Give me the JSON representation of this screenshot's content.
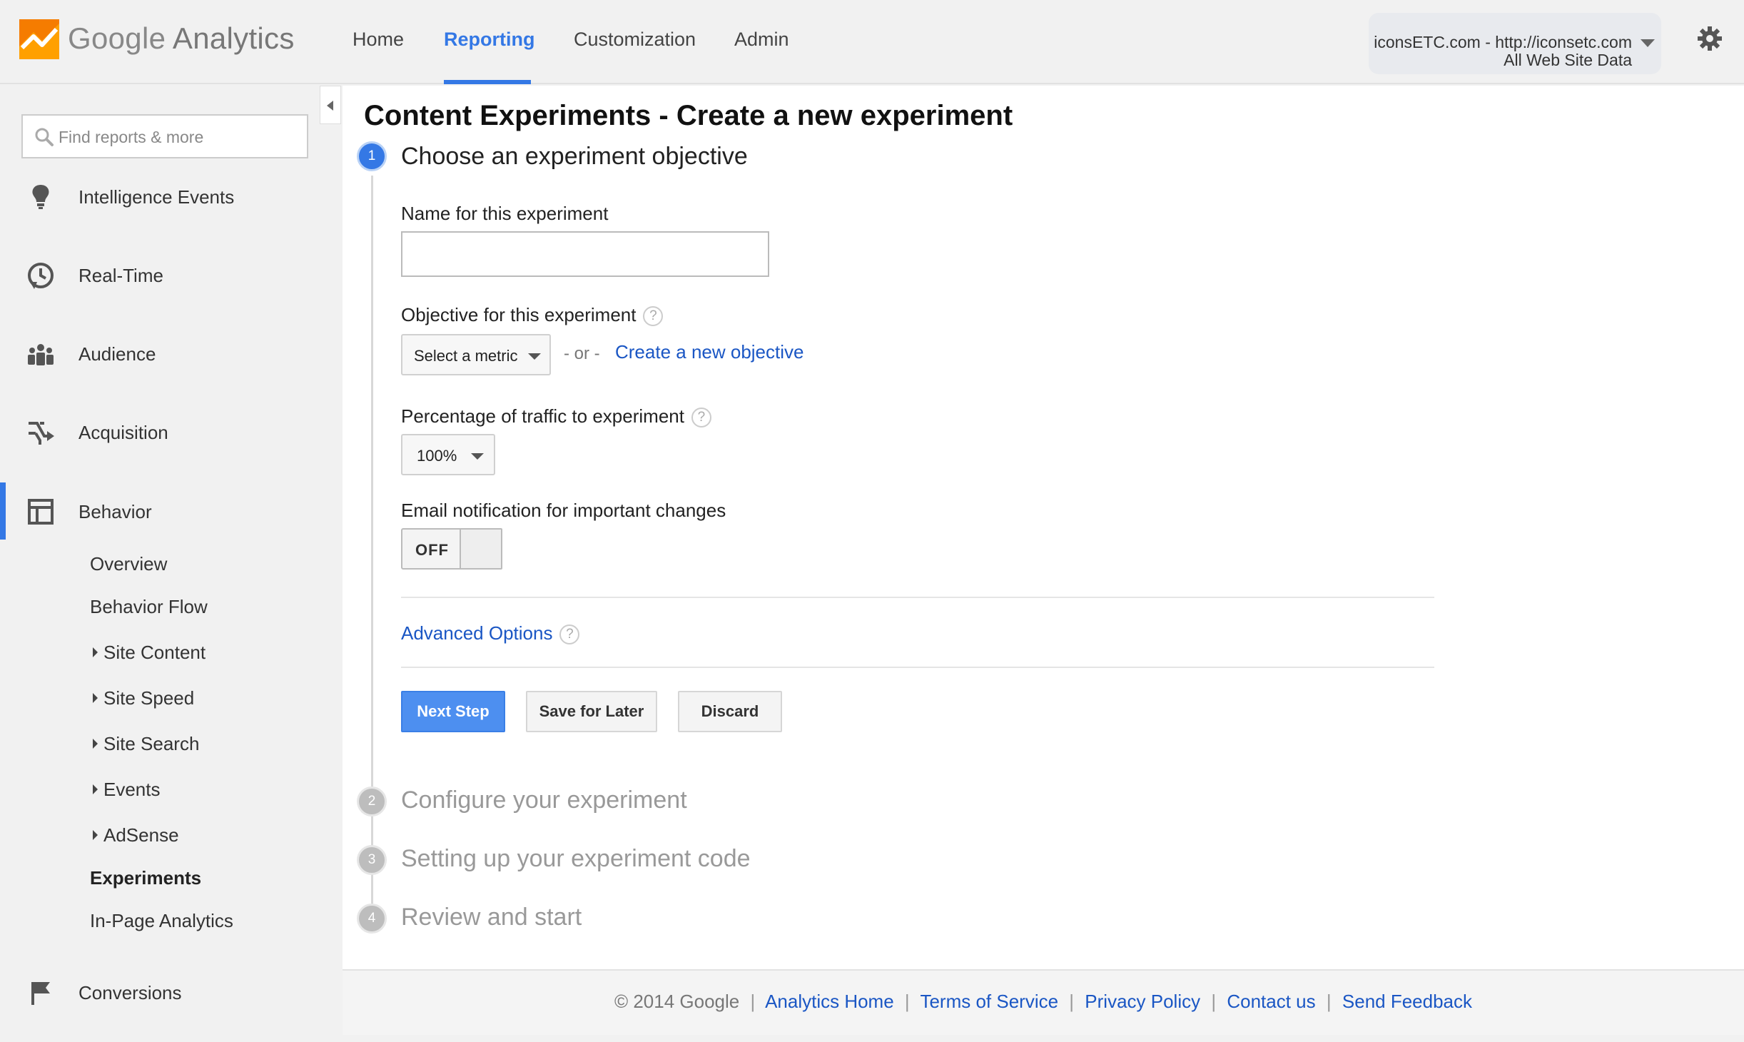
{
  "header": {
    "brand_google": "Google",
    "brand_product": "Analytics",
    "nav": [
      {
        "label": "Home",
        "active": false
      },
      {
        "label": "Reporting",
        "active": true
      },
      {
        "label": "Customization",
        "active": false
      },
      {
        "label": "Admin",
        "active": false
      }
    ],
    "account": {
      "name": "iconsETC.com - http://iconsetc.com",
      "view": "All Web Site Data"
    },
    "colors": {
      "accent": "#3478e5",
      "logo_orange": "#f57c00",
      "logo_amber": "#ffa000"
    }
  },
  "sidebar": {
    "search_placeholder": "Find reports & more",
    "main_items": [
      {
        "label": "Intelligence Events",
        "icon": "lightbulb-icon"
      },
      {
        "label": "Real-Time",
        "icon": "clock-icon"
      },
      {
        "label": "Audience",
        "icon": "people-icon"
      },
      {
        "label": "Acquisition",
        "icon": "acquisition-arrows-icon"
      },
      {
        "label": "Behavior",
        "icon": "behavior-layout-icon",
        "active": true
      },
      {
        "label": "Conversions",
        "icon": "flag-icon"
      }
    ],
    "behavior_sub": [
      {
        "label": "Overview",
        "expandable": false
      },
      {
        "label": "Behavior Flow",
        "expandable": false
      },
      {
        "label": "Site Content",
        "expandable": true
      },
      {
        "label": "Site Speed",
        "expandable": true
      },
      {
        "label": "Site Search",
        "expandable": true
      },
      {
        "label": "Events",
        "expandable": true
      },
      {
        "label": "AdSense",
        "expandable": true
      },
      {
        "label": "Experiments",
        "expandable": false,
        "selected": true
      },
      {
        "label": "In-Page Analytics",
        "expandable": false
      }
    ]
  },
  "main": {
    "title": "Content Experiments - Create a new experiment",
    "steps": [
      {
        "number": "1",
        "title": "Choose an experiment objective",
        "active": true
      },
      {
        "number": "2",
        "title": "Configure your experiment",
        "active": false
      },
      {
        "number": "3",
        "title": "Setting up your experiment code",
        "active": false
      },
      {
        "number": "4",
        "title": "Review and start",
        "active": false
      }
    ],
    "form": {
      "name_label": "Name for this experiment",
      "name_value": "",
      "objective_label": "Objective for this experiment",
      "objective_select": "Select a metric",
      "or_text": "- or -",
      "create_objective": "Create a new objective",
      "traffic_label": "Percentage of traffic to experiment",
      "traffic_select": "100%",
      "email_label": "Email notification for important changes",
      "email_toggle": "OFF",
      "help_glyph": "?",
      "advanced_options": "Advanced Options"
    },
    "buttons": {
      "next": "Next Step",
      "save": "Save for Later",
      "discard": "Discard"
    }
  },
  "footer": {
    "copyright": "© 2014 Google",
    "separator": "|",
    "links": [
      "Analytics Home",
      "Terms of Service",
      "Privacy Policy",
      "Contact us",
      "Send Feedback"
    ]
  }
}
